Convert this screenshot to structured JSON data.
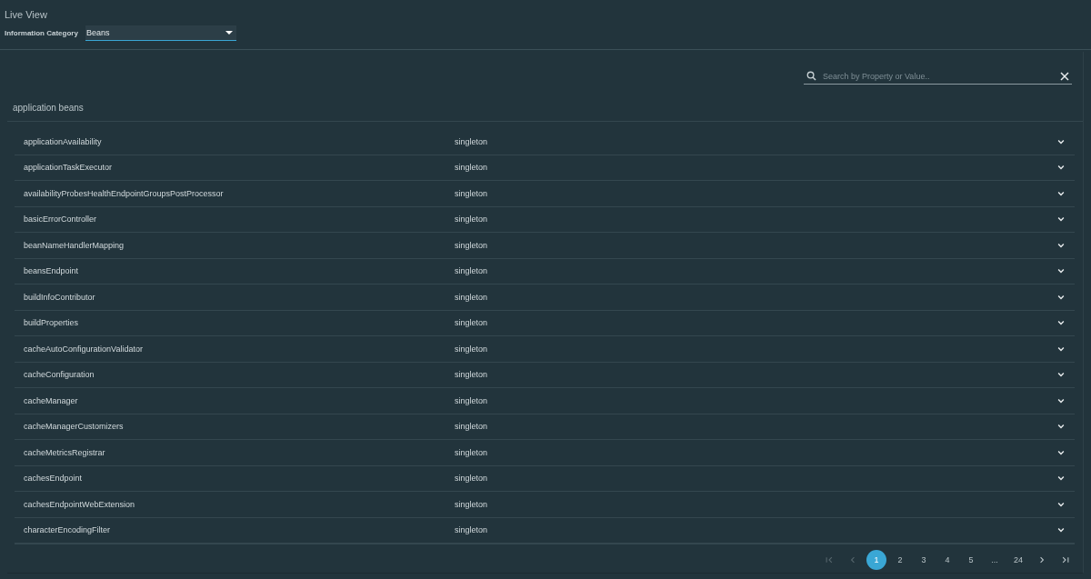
{
  "header": {
    "title": "Live View",
    "category_label": "Information Category",
    "category_value": "Beans"
  },
  "search": {
    "placeholder": "Search by Property or Value.."
  },
  "section": {
    "title": "application beans"
  },
  "rows": [
    {
      "name": "applicationAvailability",
      "scope": "singleton",
      "expanded": false
    },
    {
      "name": "applicationTaskExecutor",
      "scope": "singleton",
      "expanded": false
    },
    {
      "name": "availabilityProbesHealthEndpointGroupsPostProcessor",
      "scope": "singleton",
      "expanded": false
    },
    {
      "name": "basicErrorController",
      "scope": "singleton",
      "expanded": false
    },
    {
      "name": "beanNameHandlerMapping",
      "scope": "singleton",
      "expanded": false
    },
    {
      "name": "beansEndpoint",
      "scope": "singleton",
      "expanded": false
    },
    {
      "name": "buildInfoContributor",
      "scope": "singleton",
      "expanded": false
    },
    {
      "name": "buildProperties",
      "scope": "singleton",
      "expanded": false
    },
    {
      "name": "cacheAutoConfigurationValidator",
      "scope": "singleton",
      "expanded": false
    },
    {
      "name": "cacheConfiguration",
      "scope": "singleton",
      "expanded": false
    },
    {
      "name": "cacheManager",
      "scope": "singleton",
      "expanded": false
    },
    {
      "name": "cacheManagerCustomizers",
      "scope": "singleton",
      "expanded": false
    },
    {
      "name": "cacheMetricsRegistrar",
      "scope": "singleton",
      "expanded": false
    },
    {
      "name": "cachesEndpoint",
      "scope": "singleton",
      "expanded": false
    },
    {
      "name": "cachesEndpointWebExtension",
      "scope": "singleton",
      "expanded": false
    },
    {
      "name": "characterEncodingFilter",
      "scope": "singleton",
      "expanded": false
    }
  ],
  "pagination": {
    "nav_start": [
      {
        "kind": "first",
        "disabled": true
      },
      {
        "kind": "prev",
        "disabled": true
      }
    ],
    "pages": [
      {
        "label": "1",
        "selected": true
      },
      {
        "label": "2",
        "selected": false
      },
      {
        "label": "3",
        "selected": false
      },
      {
        "label": "4",
        "selected": false
      },
      {
        "label": "5",
        "selected": false
      },
      {
        "label": "...",
        "selected": false
      },
      {
        "label": "24",
        "selected": false
      }
    ],
    "nav_end": [
      {
        "kind": "next",
        "disabled": false
      },
      {
        "kind": "last",
        "disabled": false
      }
    ]
  }
}
